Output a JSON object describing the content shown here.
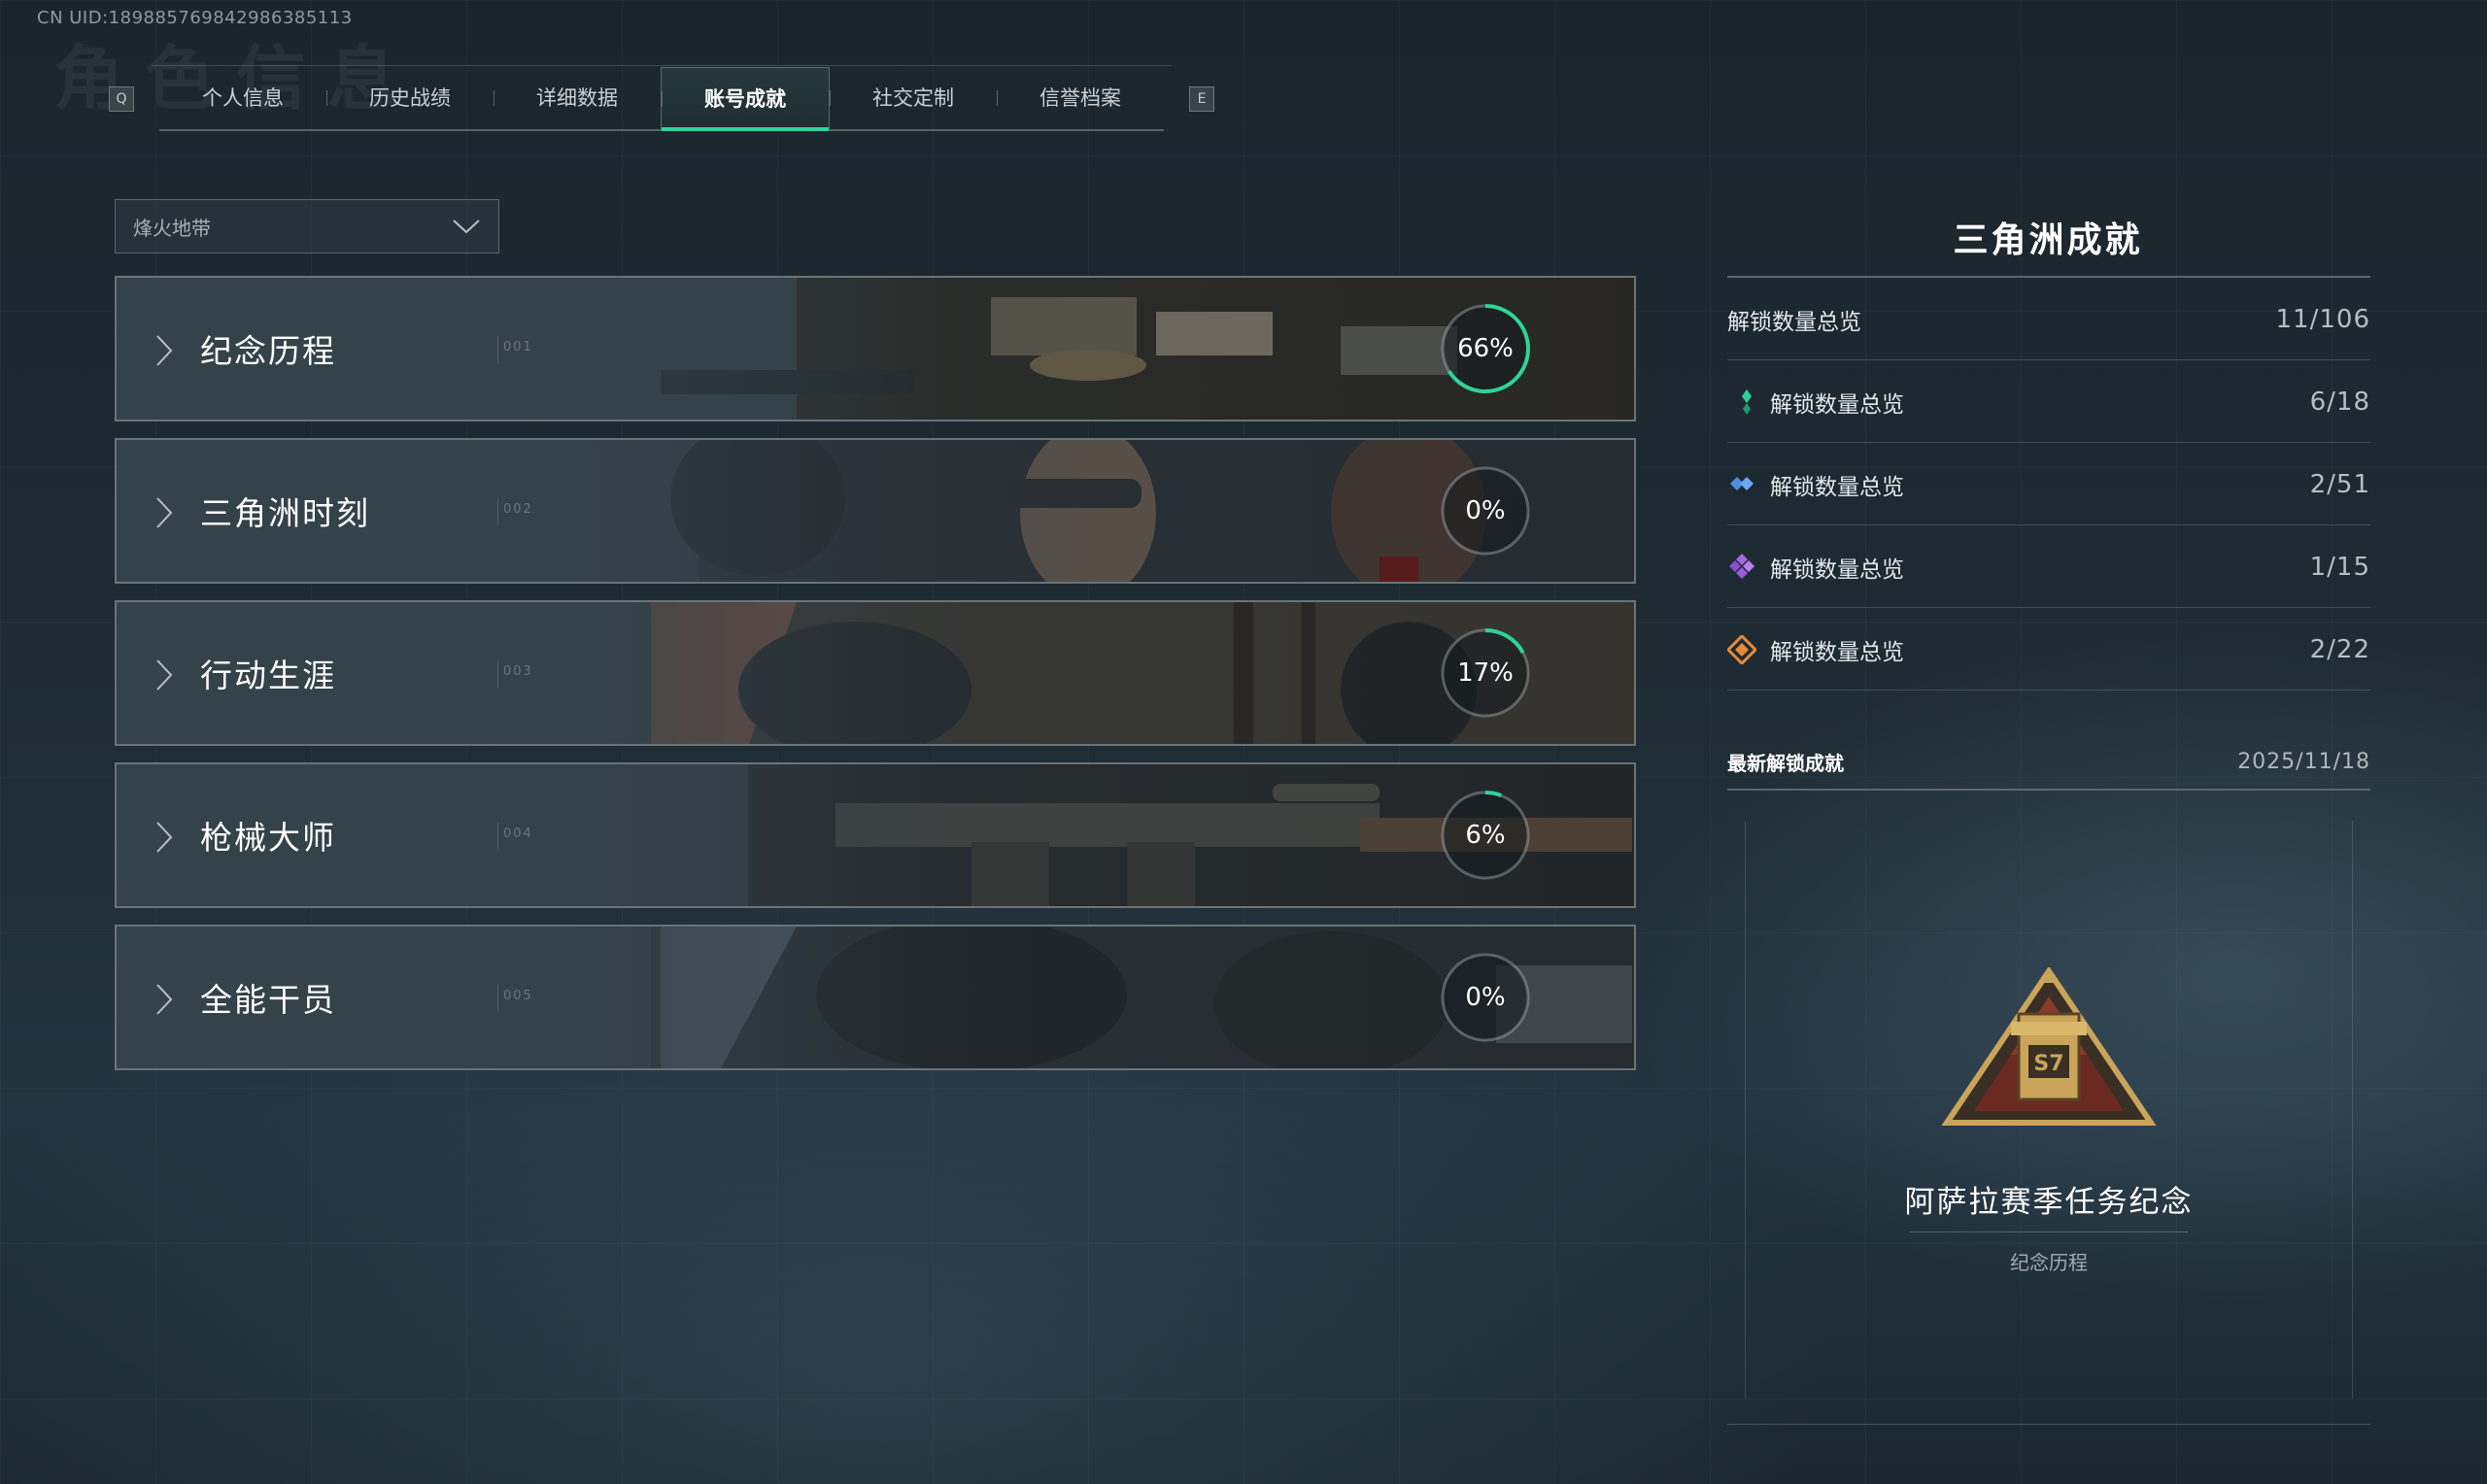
{
  "uid": "CN UID:18988576984298638​5113",
  "ghost_title": "角色信息",
  "tabbar": {
    "prev_key": "Q",
    "next_key": "E",
    "tabs": [
      "个人信息",
      "历史战绩",
      "详细数据",
      "账号成就",
      "社交定制",
      "信誉档案"
    ],
    "active_tab": "账号成就",
    "accent_color": "#2fd39a"
  },
  "mode_select": {
    "value": "烽火地带"
  },
  "categories": [
    {
      "name": "纪念历程",
      "index": "001",
      "progress": 66,
      "percent_label": "66%"
    },
    {
      "name": "三角洲时刻",
      "index": "002",
      "progress": 0,
      "percent_label": "0%"
    },
    {
      "name": "行动生涯",
      "index": "003",
      "progress": 17,
      "percent_label": "17%"
    },
    {
      "name": "枪械大师",
      "index": "004",
      "progress": 6,
      "percent_label": "6%"
    },
    {
      "name": "全能干员",
      "index": "005",
      "progress": 0,
      "percent_label": "0%"
    }
  ],
  "summary": {
    "title": "三角洲成就",
    "rows": [
      {
        "label": "解锁数量总览",
        "value": "11/106",
        "icon": "none"
      },
      {
        "label": "解锁数量总览",
        "value": "6/18",
        "icon": "green-diamond-icon",
        "color": "#2fd39a"
      },
      {
        "label": "解锁数量总览",
        "value": "2/51",
        "icon": "blue-diamond-icon",
        "color": "#4a8fe0"
      },
      {
        "label": "解锁数量总览",
        "value": "1/15",
        "icon": "purple-diamond-icon",
        "color": "#a467e0"
      },
      {
        "label": "解锁数量总览",
        "value": "2/22",
        "icon": "orange-diamond-icon",
        "color": "#e88a3c"
      }
    ]
  },
  "latest": {
    "header": "最新解锁成就",
    "date": "2025/11/18",
    "achievement_name": "阿萨拉赛季任务纪念",
    "achievement_category": "纪念历程",
    "badge_text": "S7"
  }
}
